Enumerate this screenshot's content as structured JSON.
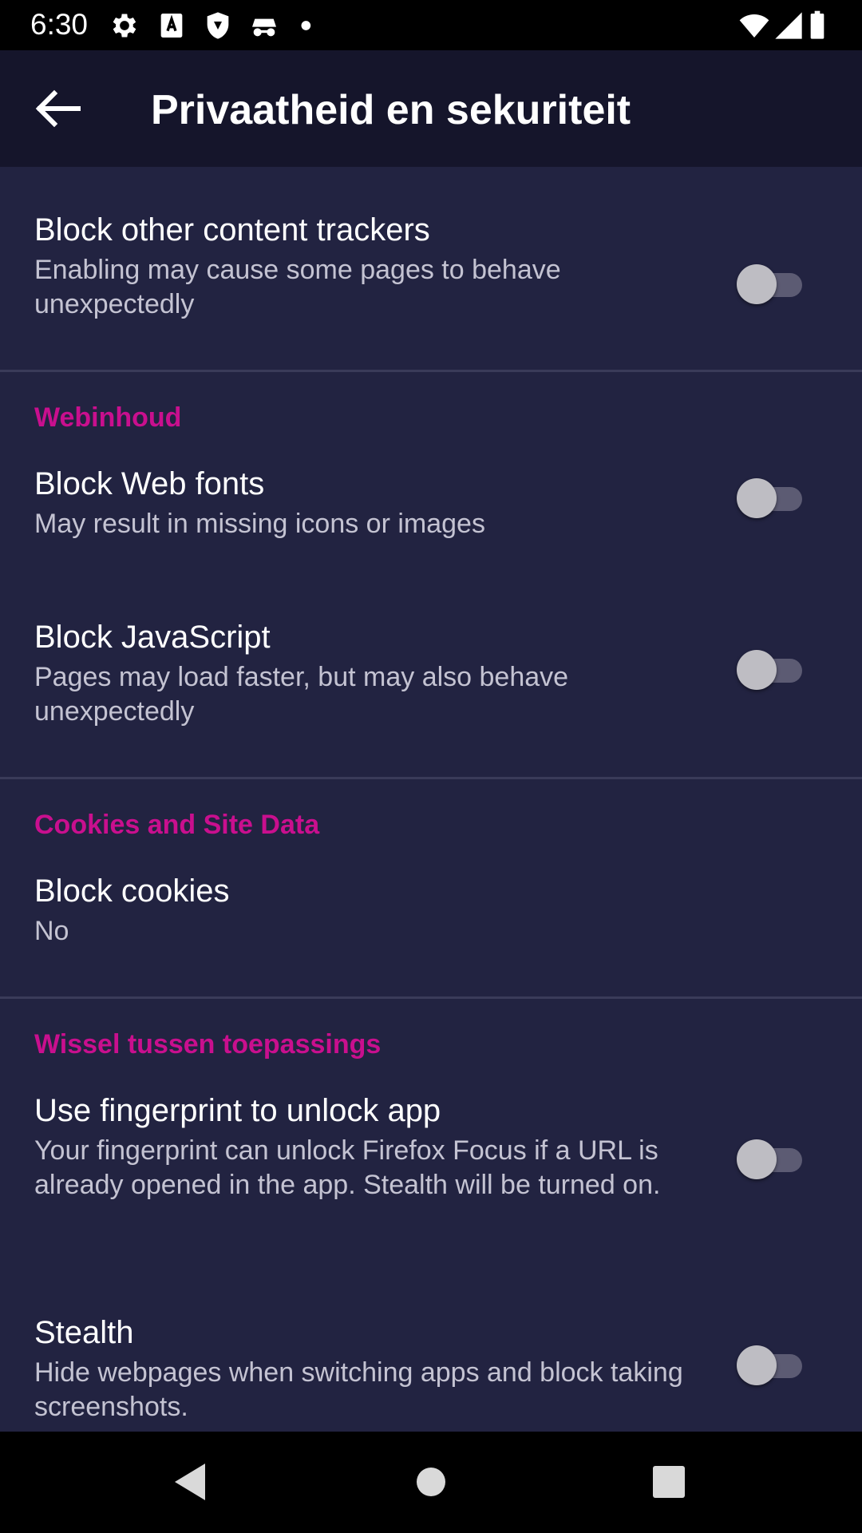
{
  "status_bar": {
    "time": "6:30",
    "left_icons": [
      "gear-icon",
      "translate-a-icon",
      "shield-icon",
      "incognito-icon",
      "dot-icon"
    ],
    "right_icons": [
      "wifi-icon",
      "cell-signal-icon",
      "battery-icon"
    ]
  },
  "app_bar": {
    "back_icon": "arrow-left-icon",
    "title": "Privaatheid en sekuriteit"
  },
  "settings": {
    "other_trackers": {
      "title": "Block other content trackers",
      "summary": "Enabling may cause some pages to behave unexpectedly",
      "enabled": false
    },
    "web_content_header": "Webinhoud",
    "web_fonts": {
      "title": "Block Web fonts",
      "summary": "May result in missing icons or images",
      "enabled": false
    },
    "javascript": {
      "title": "Block JavaScript",
      "summary": "Pages may load faster, but may also behave unexpectedly",
      "enabled": false
    },
    "cookies_header": "Cookies and Site Data",
    "cookies": {
      "title": "Block cookies",
      "summary": "No"
    },
    "switching_header": "Wissel tussen toepassings",
    "fingerprint": {
      "title": "Use fingerprint to unlock app",
      "summary": "Your fingerprint can unlock Firefox Focus if a URL is already opened in the app. Stealth will be turned on.",
      "enabled": false
    },
    "stealth": {
      "title": "Stealth",
      "summary": "Hide webpages when switching apps and block taking screenshots.",
      "enabled": false
    }
  },
  "nav_bar": {
    "back_icon": "triangle-back-icon",
    "home_icon": "circle-home-icon",
    "recents_icon": "square-recents-icon"
  },
  "colors": {
    "background": "#222341",
    "app_bar": "#15152b",
    "accent": "#c90f8e",
    "summary_text": "#c4c3d2",
    "divider": "#3a3b59"
  }
}
